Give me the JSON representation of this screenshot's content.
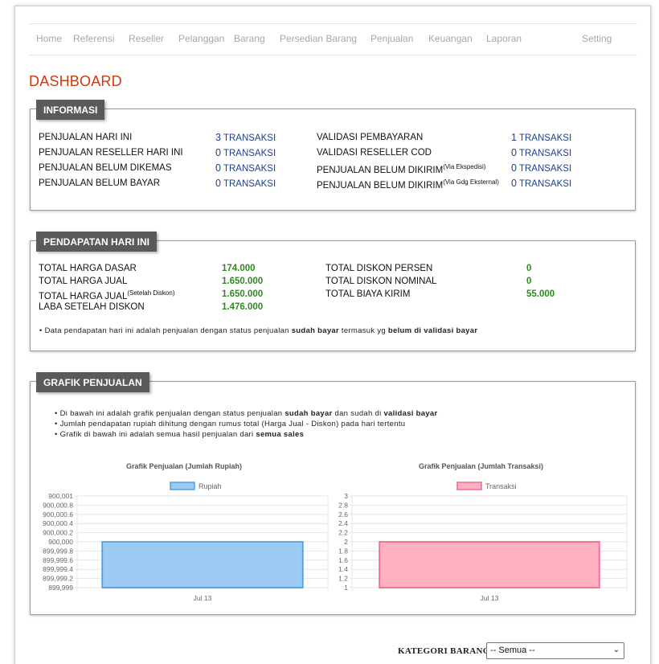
{
  "nav": [
    "Home",
    "Referensi",
    "Reseller",
    "Pelanggan",
    "Barang",
    "Persedian Barang",
    "Penjualan",
    "Keuangan",
    "Laporan",
    "Setting"
  ],
  "page_title": "DASHBOARD",
  "informasi": {
    "legend": "INFORMASI",
    "unit": "TRANSAKSI",
    "left": [
      {
        "label": "PENJUALAN HARI INI",
        "count": "3"
      },
      {
        "label": "PENJUALAN RESELLER HARI INI",
        "count": "0"
      },
      {
        "label": "PENJUALAN BELUM DIKEMAS",
        "count": "0"
      },
      {
        "label": "PENJUALAN BELUM BAYAR",
        "count": "0"
      }
    ],
    "right": [
      {
        "label": "VALIDASI PEMBAYARAN",
        "sup": "",
        "count": "1"
      },
      {
        "label": "VALIDASI RESELLER COD",
        "sup": "",
        "count": "0"
      },
      {
        "label": "PENJUALAN BELUM DIKIRIM",
        "sup": "(Via Ekspedisi)",
        "count": "0"
      },
      {
        "label": "PENJUALAN BELUM DIKIRIM",
        "sup": "(Via Gdg Eksternal)",
        "count": "0"
      }
    ]
  },
  "pendapatan": {
    "legend": "PENDAPATAN HARI INI",
    "left": [
      {
        "label": "TOTAL HARGA DASAR",
        "sup": "",
        "value": "174.000"
      },
      {
        "label": "TOTAL HARGA JUAL",
        "sup": "",
        "value": "1.650.000"
      },
      {
        "label": "TOTAL HARGA JUAL",
        "sup": "(Setelah Diskon)",
        "value": "1.650.000"
      },
      {
        "label": "LABA SETELAH DISKON",
        "sup": "",
        "value": "1.476.000"
      }
    ],
    "right": [
      {
        "label": "TOTAL DISKON PERSEN",
        "value": "0"
      },
      {
        "label": "TOTAL DISKON NOMINAL",
        "value": "0"
      },
      {
        "label": "TOTAL BIAYA KIRIM",
        "value": "55.000"
      }
    ],
    "note": {
      "prefix": "• Data pendapatan hari ini adalah penjualan dengan status penjualan ",
      "bold1": "sudah bayar",
      "mid": " termasuk yg ",
      "bold2": "belum di validasi bayar"
    }
  },
  "grafik": {
    "legend": "GRAFIK PENJUALAN",
    "notes": [
      {
        "prefix": "• Di bawah ini adalah grafik penjualan dengan status penjualan ",
        "bold1": "sudah bayar",
        "mid": " dan sudah di ",
        "bold2": "validasi bayar"
      },
      {
        "prefix": "• Jumlah pendapatan rupiah dihitung dengan rumus total (Harga Jual - Diskon) pada hari tertentu",
        "bold1": "",
        "mid": "",
        "bold2": ""
      },
      {
        "prefix": "• Grafik di bawah ini adalah semua hasil penjualan dari ",
        "bold1": "semua sales",
        "mid": "",
        "bold2": ""
      }
    ]
  },
  "chart_data": [
    {
      "type": "bar",
      "title": "Grafik Penjualan (Jumlah Rupiah)",
      "categories": [
        "Jul 13"
      ],
      "series": [
        {
          "name": "Rupiah",
          "values": [
            900000
          ]
        }
      ],
      "y_ticks": [
        "900,001",
        "900,000.8",
        "900,000.6",
        "900,000.4",
        "900,000.2",
        "900,000",
        "899,999.8",
        "899,999.6",
        "899,999.4",
        "899,999.2",
        "899,999"
      ],
      "ylim": [
        899999,
        900001
      ],
      "legend": "top",
      "grid": true,
      "fill": "#9ccaf2",
      "stroke": "#4aa3e8"
    },
    {
      "type": "bar",
      "title": "Grafik Penjualan (Jumlah Transaksi)",
      "categories": [
        "Jul 13"
      ],
      "series": [
        {
          "name": "Transaksi",
          "values": [
            2
          ]
        }
      ],
      "y_ticks": [
        "3",
        "2.8",
        "2.6",
        "2.4",
        "2.2",
        "2",
        "1.8",
        "1.6",
        "1.4",
        "1.2",
        "1"
      ],
      "ylim": [
        1,
        3
      ],
      "legend": "top",
      "grid": true,
      "fill": "#ffb0c1",
      "stroke": "#f06a8e"
    }
  ],
  "filter": {
    "label": "KATEGORI BARANG",
    "selected": "-- Semua --"
  }
}
